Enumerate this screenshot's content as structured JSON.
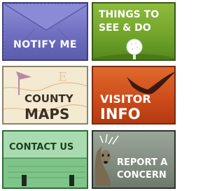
{
  "tiles": [
    {
      "id": "notify",
      "lines": [
        "NOTIFY ME"
      ],
      "icon": "envelope-icon",
      "color": "#6f6fc0"
    },
    {
      "id": "things",
      "lines": [
        "THINGS TO",
        "SEE & DO"
      ],
      "icon": "golf-ball-icon",
      "color": "#73a52b"
    },
    {
      "id": "maps",
      "lines": [
        "COUNTY",
        "MAPS"
      ],
      "icon": "map-compass-icon",
      "color": "#f4ead2"
    },
    {
      "id": "visitor",
      "lines": [
        "VISITOR",
        "INFO"
      ],
      "icon": "bird-icon",
      "color": "#cc4a1a"
    },
    {
      "id": "contact",
      "lines": [
        "CONTACT US"
      ],
      "icon": "contact-card-icon",
      "color": "#7fc58a"
    },
    {
      "id": "report",
      "lines": [
        "REPORT A",
        "CONCERN"
      ],
      "icon": "deer-icon",
      "color": "#6e7a6c"
    }
  ]
}
